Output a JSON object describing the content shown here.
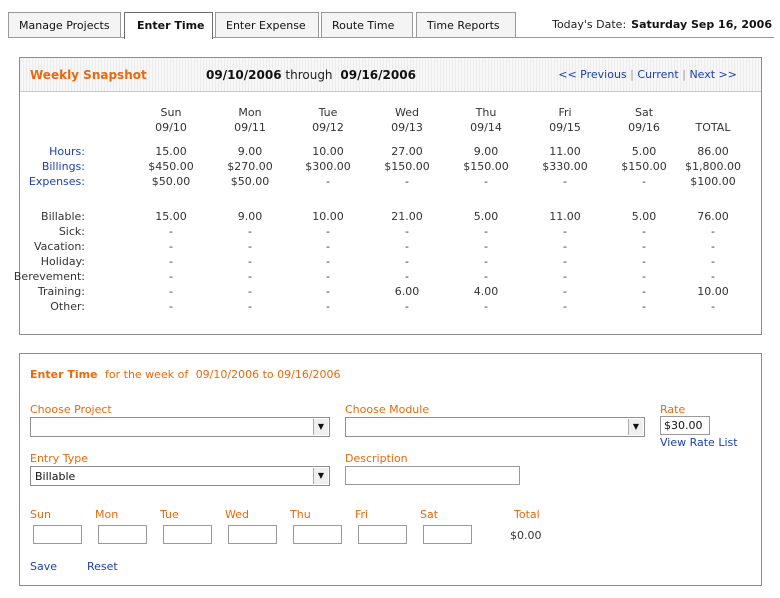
{
  "tabs": [
    {
      "label": "Manage Projects",
      "active": false
    },
    {
      "label": "Enter Time",
      "active": true
    },
    {
      "label": "Enter Expense",
      "active": false
    },
    {
      "label": "Route Time",
      "active": false
    },
    {
      "label": "Time Reports",
      "active": false
    }
  ],
  "today": {
    "label": "Today's Date:",
    "value": "Saturday Sep 16, 2006"
  },
  "snapshot": {
    "title": "Weekly Snapshot",
    "start": "09/10/2006",
    "through": "through",
    "end": "09/16/2006",
    "nav": {
      "previous": "<< Previous",
      "current": "Current",
      "next": "Next >>",
      "sep": "|"
    },
    "days": [
      {
        "name": "Sun",
        "date": "09/10"
      },
      {
        "name": "Mon",
        "date": "09/11"
      },
      {
        "name": "Tue",
        "date": "09/12"
      },
      {
        "name": "Wed",
        "date": "09/13"
      },
      {
        "name": "Thu",
        "date": "09/14"
      },
      {
        "name": "Fri",
        "date": "09/15"
      },
      {
        "name": "Sat",
        "date": "09/16"
      }
    ],
    "total_label": "TOTAL",
    "summary_rows": [
      {
        "label": "Hours:",
        "values": [
          "15.00",
          "9.00",
          "10.00",
          "27.00",
          "9.00",
          "11.00",
          "5.00",
          "86.00"
        ]
      },
      {
        "label": "Billings:",
        "values": [
          "$450.00",
          "$270.00",
          "$300.00",
          "$150.00",
          "$150.00",
          "$330.00",
          "$150.00",
          "$1,800.00"
        ]
      },
      {
        "label": "Expenses:",
        "values": [
          "$50.00",
          "$50.00",
          "-",
          "-",
          "-",
          "-",
          "-",
          "$100.00"
        ]
      }
    ],
    "type_rows": [
      {
        "label": "Billable:",
        "values": [
          "15.00",
          "9.00",
          "10.00",
          "21.00",
          "5.00",
          "11.00",
          "5.00",
          "76.00"
        ]
      },
      {
        "label": "Sick:",
        "values": [
          "-",
          "-",
          "-",
          "-",
          "-",
          "-",
          "-",
          "-"
        ]
      },
      {
        "label": "Vacation:",
        "values": [
          "-",
          "-",
          "-",
          "-",
          "-",
          "-",
          "-",
          "-"
        ]
      },
      {
        "label": "Holiday:",
        "values": [
          "-",
          "-",
          "-",
          "-",
          "-",
          "-",
          "-",
          "-"
        ]
      },
      {
        "label": "Berevement:",
        "values": [
          "-",
          "-",
          "-",
          "-",
          "-",
          "-",
          "-",
          "-"
        ]
      },
      {
        "label": "Training:",
        "values": [
          "-",
          "-",
          "-",
          "6.00",
          "4.00",
          "-",
          "-",
          "10.00"
        ]
      },
      {
        "label": "Other:",
        "values": [
          "-",
          "-",
          "-",
          "-",
          "-",
          "-",
          "-",
          "-"
        ]
      }
    ]
  },
  "entry": {
    "title": "Enter Time",
    "week_text": "for the week of",
    "week_start": "09/10/2006",
    "to": "to",
    "week_end": "09/16/2006",
    "project": {
      "label": "Choose Project",
      "value": ""
    },
    "module": {
      "label": "Choose Module",
      "value": ""
    },
    "rate": {
      "label": "Rate",
      "value": "$30.00",
      "link": "View Rate List"
    },
    "entry_type": {
      "label": "Entry Type",
      "value": "Billable"
    },
    "description": {
      "label": "Description",
      "value": ""
    },
    "day_fields": [
      {
        "label": "Sun",
        "value": ""
      },
      {
        "label": "Mon",
        "value": ""
      },
      {
        "label": "Tue",
        "value": ""
      },
      {
        "label": "Wed",
        "value": ""
      },
      {
        "label": "Thu",
        "value": ""
      },
      {
        "label": "Fri",
        "value": ""
      },
      {
        "label": "Sat",
        "value": ""
      }
    ],
    "total": {
      "label": "Total",
      "value": "$0.00"
    },
    "save": "Save",
    "reset": "Reset"
  },
  "colors": {
    "accent": "#e8690c",
    "link": "#1c3fa9",
    "border": "#8e8e8e"
  },
  "icons": {
    "select_arrow": "chevron-down-icon"
  }
}
